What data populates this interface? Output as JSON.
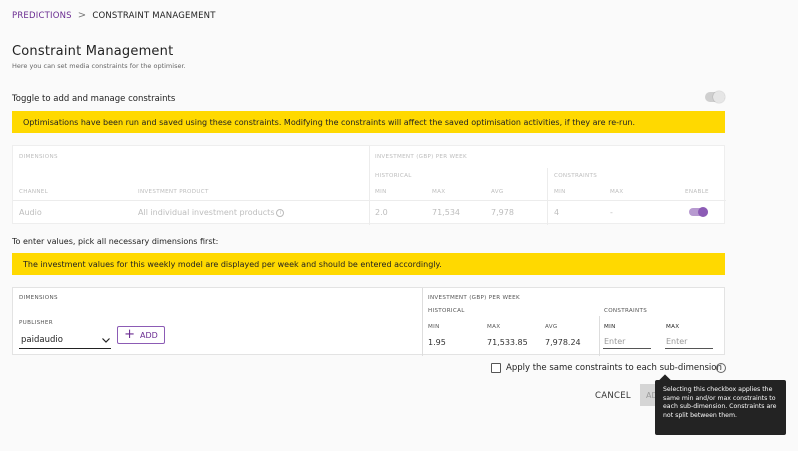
{
  "breadcrumb": {
    "link": "PREDICTIONS",
    "separator": ">",
    "current": "CONSTRAINT MANAGEMENT"
  },
  "page": {
    "title": "Constraint Management",
    "subtitle": "Here you can set media constraints for the optimiser."
  },
  "toggle_section": {
    "label": "Toggle to add and manage constraints",
    "enabled": false
  },
  "banner_top": "Optimisations have been run and saved using these constraints. Modifying the constraints will affect the saved optimisation activities, if they are re-run.",
  "saved_table": {
    "dimensions_header": "DIMENSIONS",
    "investment_header": "INVESTMENT (GBP) PER WEEK",
    "historical_header": "HISTORICAL",
    "constraints_header": "CONSTRAINTS",
    "columns": {
      "channel": "CHANNEL",
      "investment_product": "INVESTMENT PRODUCT",
      "min": "MIN",
      "max": "MAX",
      "avg": "AVG",
      "c_min": "MIN",
      "c_max": "MAX",
      "enable": "ENABLE"
    },
    "row": {
      "channel": "Audio",
      "investment_product": "All individual investment products",
      "min": "2.0",
      "max": "71,534",
      "avg": "7,978",
      "c_min": "4",
      "c_max": "-",
      "enabled": true
    }
  },
  "enter_label": "To enter values, pick all necessary dimensions first:",
  "banner_weekly": "The investment values for this weekly model are displayed per week and should be entered accordingly.",
  "entry_table": {
    "dimensions_header": "DIMENSIONS",
    "publisher_label": "PUBLISHER",
    "publisher_value": "paidaudio",
    "add_label": "ADD",
    "investment_header": "INVESTMENT (GBP) PER WEEK",
    "historical_header": "HISTORICAL",
    "constraints_header": "CONSTRAINTS",
    "columns": {
      "min": "MIN",
      "max": "MAX",
      "avg": "AVG",
      "c_min": "MIN",
      "c_max": "MAX"
    },
    "values": {
      "min": "1.95",
      "max": "71,533.85",
      "avg": "7,978.24"
    },
    "min_placeholder": "Enter",
    "max_placeholder": "Enter"
  },
  "checkbox": {
    "label": "Apply the same constraints to each sub-dimension",
    "checked": false
  },
  "tooltip": "Selecting this checkbox applies the same min and/or max constraints to each sub-dimension. Constraints are not split between them.",
  "actions": {
    "cancel": "CANCEL",
    "apply": "AD"
  },
  "colors": {
    "brand": "#6a2c91",
    "banner": "#ffd900",
    "toggle_on": "#8c5bb5"
  }
}
